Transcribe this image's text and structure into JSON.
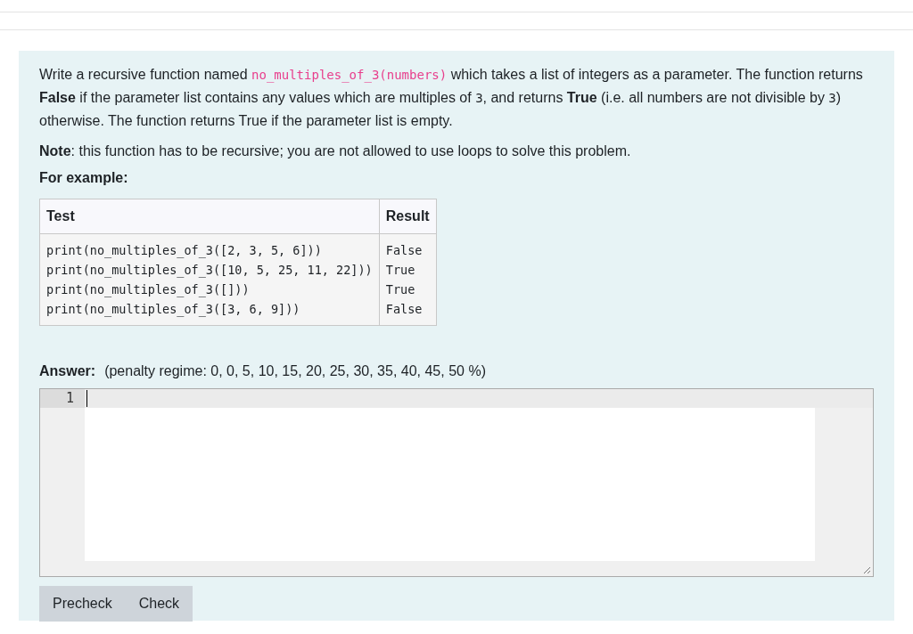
{
  "question": {
    "paragraphs": [
      {
        "parts": [
          {
            "kind": "text",
            "text": "Write a recursive function named "
          },
          {
            "kind": "code",
            "text": "no_multiples_of_3(numbers)"
          },
          {
            "kind": "text",
            "text": " which takes a list of integers as a parameter. The function returns **False** if the parameter list contains any values which are multiples of "
          },
          {
            "kind": "mono",
            "text": "3"
          },
          {
            "kind": "text",
            "text": ", and returns **True** (i.e. all numbers are not divisible by "
          },
          {
            "kind": "mono",
            "text": "3"
          },
          {
            "kind": "text",
            "text": ") otherwise. The function returns True if the parameter list is empty."
          }
        ]
      },
      {
        "parts": [
          {
            "kind": "text",
            "text": "**Note**: this function has to be recursive; you are not allowed to use loops to solve this problem."
          }
        ]
      }
    ],
    "example_heading": "For example:",
    "table": {
      "columns": [
        "Test",
        "Result"
      ],
      "rows": [
        {
          "test": "print(no_multiples_of_3([2, 3, 5, 6]))",
          "result": "False"
        },
        {
          "test": "print(no_multiples_of_3([10, 5, 25, 11, 22]))",
          "result": "True"
        },
        {
          "test": "print(no_multiples_of_3([]))",
          "result": "True"
        },
        {
          "test": "print(no_multiples_of_3([3, 6, 9]))",
          "result": "False"
        }
      ]
    }
  },
  "answer": {
    "label": "Answer:",
    "penalty": "(penalty regime: 0, 0, 5, 10, 15, 20, 25, 30, 35, 40, 45, 50 %)",
    "line_numbers": [
      "1"
    ]
  },
  "buttons": [
    "Precheck",
    "Check"
  ]
}
